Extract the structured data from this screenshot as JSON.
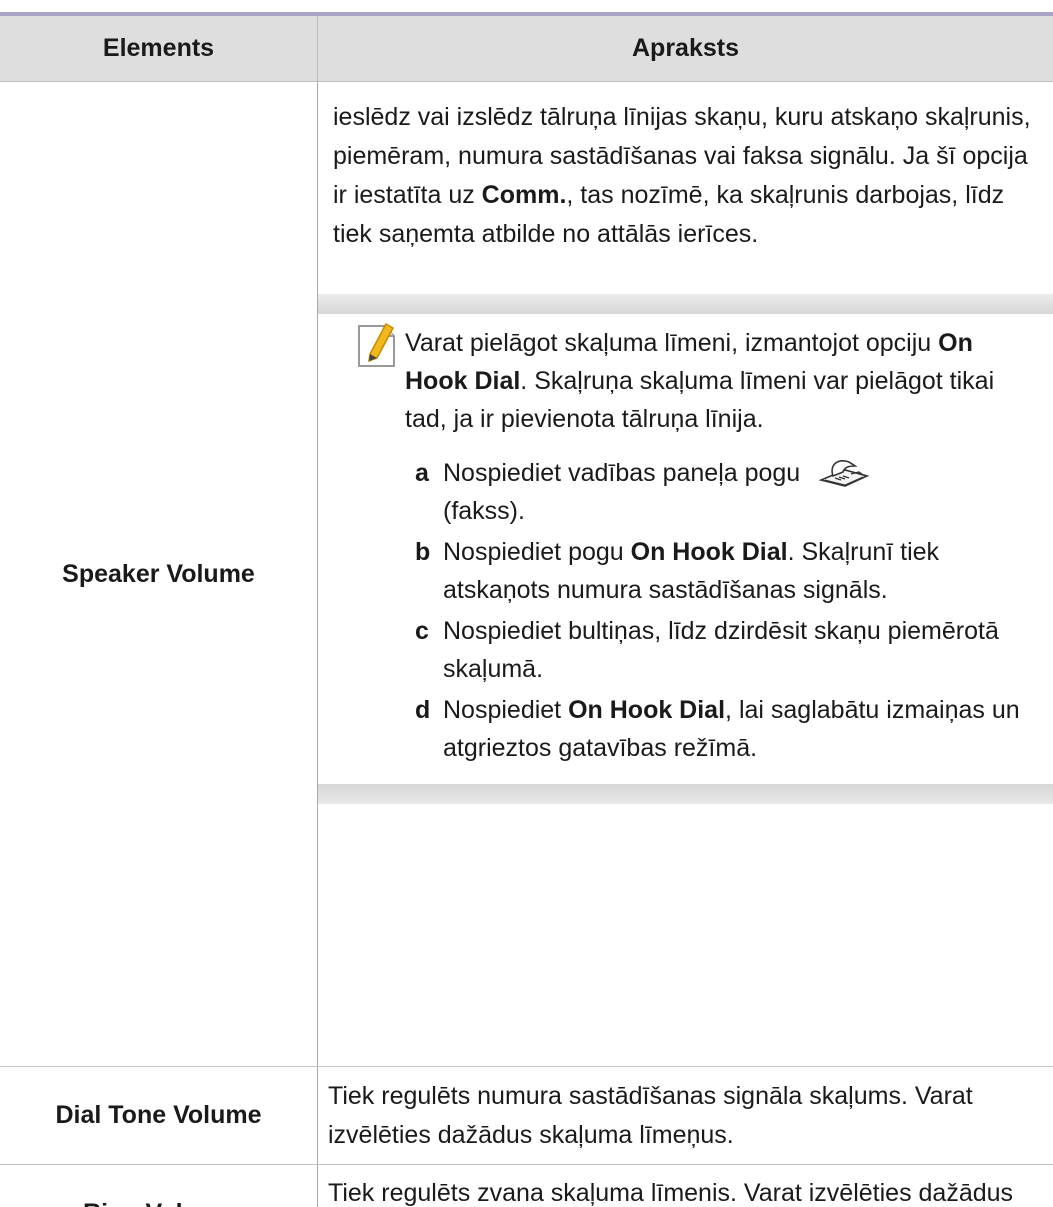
{
  "table": {
    "header": {
      "col1": "Elements",
      "col2": "Apraksts"
    },
    "speaker": {
      "name": "Speaker Volume",
      "desc_part1": "ieslēdz vai izslēdz tālruņa līnijas skaņu, kuru atskaņo skaļrunis, piemēram, numura sastādīšanas vai faksa signālu. Ja šī opcija ir iestatīta uz ",
      "desc_bold": "Comm.",
      "desc_part2": ", tas nozīmē, ka skaļrunis darbojas, līdz tiek saņemta atbilde no attālās ierīces.",
      "note": {
        "icon": "note-pencil-icon",
        "text_part1": "Varat pielāgot skaļuma līmeni, izmantojot opciju ",
        "text_bold": "On Hook Dial",
        "text_part2": ". Skaļruņa skaļuma līmeni var pielāgot tikai tad, ja ir pievienota tālruņa līnija.",
        "steps": [
          {
            "letter": "a",
            "text1": "Nospiediet vadības paneļa pogu ",
            "bold": "",
            "text2": "(fakss).",
            "icon": "fax-icon"
          },
          {
            "letter": "b",
            "text1": "Nospiediet pogu ",
            "bold": "On Hook Dial",
            "text2": ". Skaļrunī tiek atskaņots numura sastādīšanas signāls."
          },
          {
            "letter": "c",
            "text1": "Nospiediet bultiņas, līdz dzirdēsit skaņu piemērotā skaļumā.",
            "bold": "",
            "text2": ""
          },
          {
            "letter": "d",
            "text1": "Nospiediet ",
            "bold": "On Hook Dial",
            "text2": ", lai saglabātu izmaiņas un atgrieztos gatavības režīmā."
          }
        ]
      }
    },
    "dial_tone": {
      "name": "Dial Tone Volume",
      "desc": "Tiek regulēts numura sastādīšanas signāla skaļums. Varat izvēlēties dažādus skaļuma līmeņus."
    },
    "ring": {
      "name": "Ring Volume",
      "desc": "Tiek regulēts zvana skaļuma līmenis. Varat izvēlēties dažādus skaļuma līmeņus."
    }
  }
}
